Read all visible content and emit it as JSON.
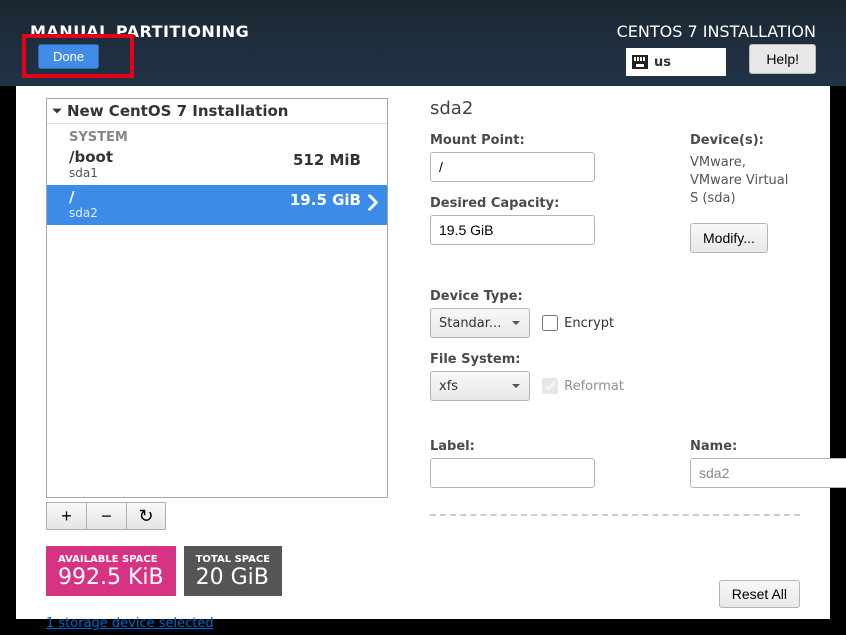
{
  "header": {
    "title": "MANUAL PARTITIONING",
    "install_label": "CENTOS 7 INSTALLATION",
    "done_label": "Done",
    "help_label": "Help!",
    "keyboard_layout": "us"
  },
  "left": {
    "tree_title": "New CentOS 7 Installation",
    "section_label": "SYSTEM",
    "rows": [
      {
        "mount": "/boot",
        "device": "sda1",
        "size": "512 MiB"
      },
      {
        "mount": "/",
        "device": "sda2",
        "size": "19.5 GiB"
      }
    ],
    "buttons": {
      "add": "+",
      "remove": "−",
      "reload": "↻"
    },
    "available": {
      "label": "AVAILABLE SPACE",
      "value": "992.5 KiB"
    },
    "total": {
      "label": "TOTAL SPACE",
      "value": "20 GiB"
    },
    "storage_link": "1 storage device selected"
  },
  "right": {
    "title": "sda2",
    "mount_point_label": "Mount Point:",
    "mount_point_value": "/",
    "desired_capacity_label": "Desired Capacity:",
    "desired_capacity_value": "19.5 GiB",
    "devices_label": "Device(s):",
    "devices_value": "VMware, VMware Virtual S (sda)",
    "modify_label": "Modify...",
    "device_type_label": "Device Type:",
    "device_type_value": "Standar...",
    "encrypt_label": "Encrypt",
    "fs_label": "File System:",
    "fs_value": "xfs",
    "reformat_label": "Reformat",
    "label_label": "Label:",
    "label_value": "",
    "name_label": "Name:",
    "name_value": "sda2",
    "reset_label": "Reset All"
  }
}
